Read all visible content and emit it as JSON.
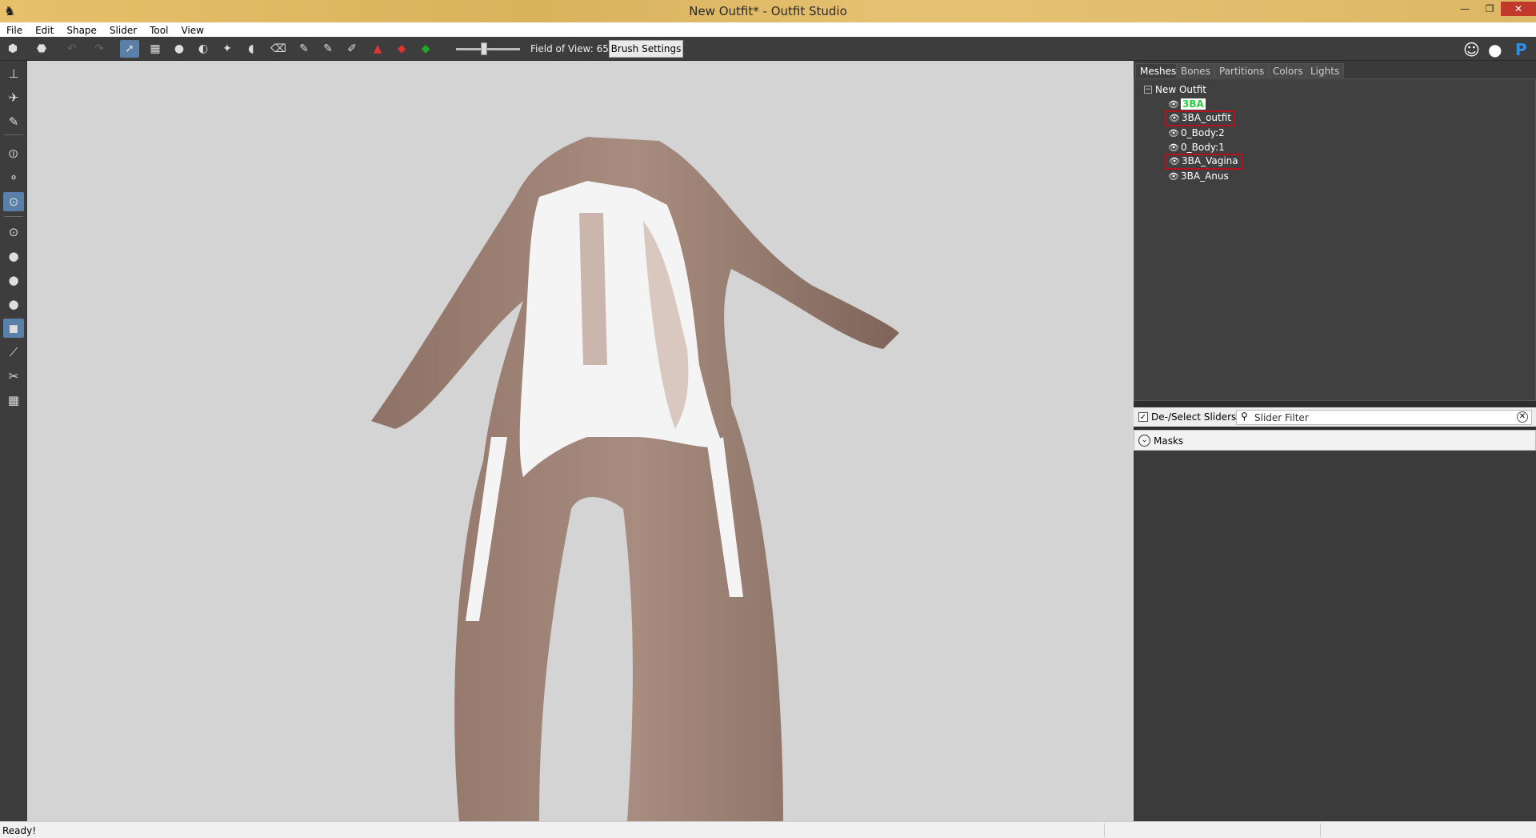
{
  "window": {
    "title": "New Outfit* - Outfit Studio",
    "min": "—",
    "max": "❐",
    "close": "✕"
  },
  "menu": [
    "File",
    "Edit",
    "Shape",
    "Slider",
    "Tool",
    "View"
  ],
  "toolbar": {
    "fov_label": "Field of View: 65",
    "fov_value": 65,
    "brush_settings": "Brush Settings"
  },
  "tabs": [
    "Meshes",
    "Bones",
    "Partitions",
    "Colors",
    "Lights"
  ],
  "tree": {
    "root": "New Outfit",
    "meshes": [
      "3BA",
      "3BA_outfit",
      "0_Body:2",
      "0_Body:1",
      "3BA_Vagina",
      "3BA_Anus"
    ]
  },
  "sliders": {
    "deselect_label": "De-/Select Sliders",
    "filter_placeholder": "Slider Filter",
    "masks_label": "Masks"
  },
  "status": {
    "text": "Ready!"
  },
  "colors": {
    "accent": "#5a7fa8",
    "selection": "#b3131e",
    "active_mesh": "#2ecc40",
    "viewport_bg": "#d4d4d4"
  }
}
